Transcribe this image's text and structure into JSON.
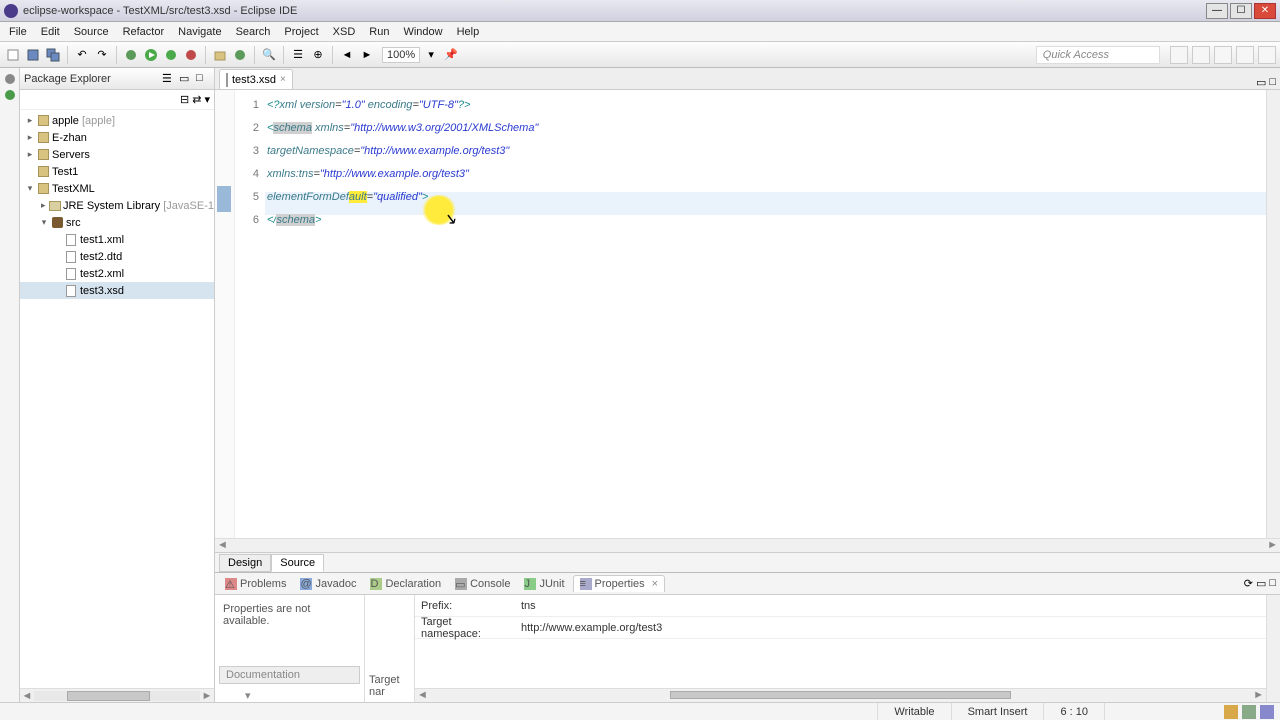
{
  "window": {
    "title": "eclipse-workspace - TestXML/src/test3.xsd - Eclipse IDE"
  },
  "menu": {
    "items": [
      "File",
      "Edit",
      "Source",
      "Refactor",
      "Navigate",
      "Search",
      "Project",
      "XSD",
      "Run",
      "Window",
      "Help"
    ]
  },
  "toolbar": {
    "zoom": "100%",
    "quick_access": "Quick Access"
  },
  "explorer": {
    "title": "Package Explorer",
    "tree": [
      {
        "label": "apple",
        "decor": "[apple]",
        "level": 0,
        "icon": "proj",
        "expander": "▸"
      },
      {
        "label": "E-zhan",
        "level": 0,
        "icon": "proj",
        "expander": "▸"
      },
      {
        "label": "Servers",
        "level": 0,
        "icon": "proj",
        "expander": "▸"
      },
      {
        "label": "Test1",
        "level": 0,
        "icon": "proj",
        "expander": ""
      },
      {
        "label": "TestXML",
        "level": 0,
        "icon": "proj",
        "expander": "▾"
      },
      {
        "label": "JRE System Library",
        "decor": "[JavaSE-1",
        "level": 1,
        "icon": "lib",
        "expander": "▸"
      },
      {
        "label": "src",
        "level": 1,
        "icon": "pkg",
        "expander": "▾"
      },
      {
        "label": "test1.xml",
        "level": 2,
        "icon": "file",
        "expander": ""
      },
      {
        "label": "test2.dtd",
        "level": 2,
        "icon": "file",
        "expander": ""
      },
      {
        "label": "test2.xml",
        "level": 2,
        "icon": "file",
        "expander": ""
      },
      {
        "label": "test3.xsd",
        "level": 2,
        "icon": "file",
        "expander": "",
        "selected": true
      }
    ]
  },
  "editor": {
    "tab": "test3.xsd",
    "lines": [
      "1",
      "2",
      "3",
      "4",
      "5",
      "6"
    ],
    "code": {
      "l1a": "<?",
      "l1b": "xml version",
      "l1c": "=",
      "l1d": "\"1.0\"",
      "l1e": " encoding",
      "l1f": "=",
      "l1g": "\"UTF-8\"",
      "l1h": "?>",
      "l2a": "<",
      "l2b": "schema",
      "l2c": " xmlns",
      "l2d": "=",
      "l2e": "\"http://www.w3.org/2001/XMLSchema\"",
      "l3a": "targetNamespace",
      "l3b": "=",
      "l3c": "\"http://www.example.org/test3\"",
      "l4a": "xmlns:tns",
      "l4b": "=",
      "l4c": "\"http://www.example.org/test3\"",
      "l5a": "elementFormDef",
      "l5b": "ault",
      "l5c": "=",
      "l5d": "\"qualified\"",
      "l5e": ">",
      "l6a": "</",
      "l6b": "schema",
      "l6c": ">"
    },
    "bottom_tabs": {
      "design": "Design",
      "source": "Source"
    }
  },
  "views": {
    "tabs": {
      "problems": "Problems",
      "javadoc": "Javadoc",
      "declaration": "Declaration",
      "console": "Console",
      "junit": "JUnit",
      "properties": "Properties"
    },
    "props_msg": "Properties are not available.",
    "left_tab": "Documentation",
    "targetnar_lbl": "Target nar",
    "prefix_label": "Prefix:",
    "prefix_value": "tns",
    "tns_label": "Target namespace:",
    "tns_value": "http://www.example.org/test3"
  },
  "status": {
    "writable": "Writable",
    "insert": "Smart Insert",
    "pos": "6 : 10"
  }
}
